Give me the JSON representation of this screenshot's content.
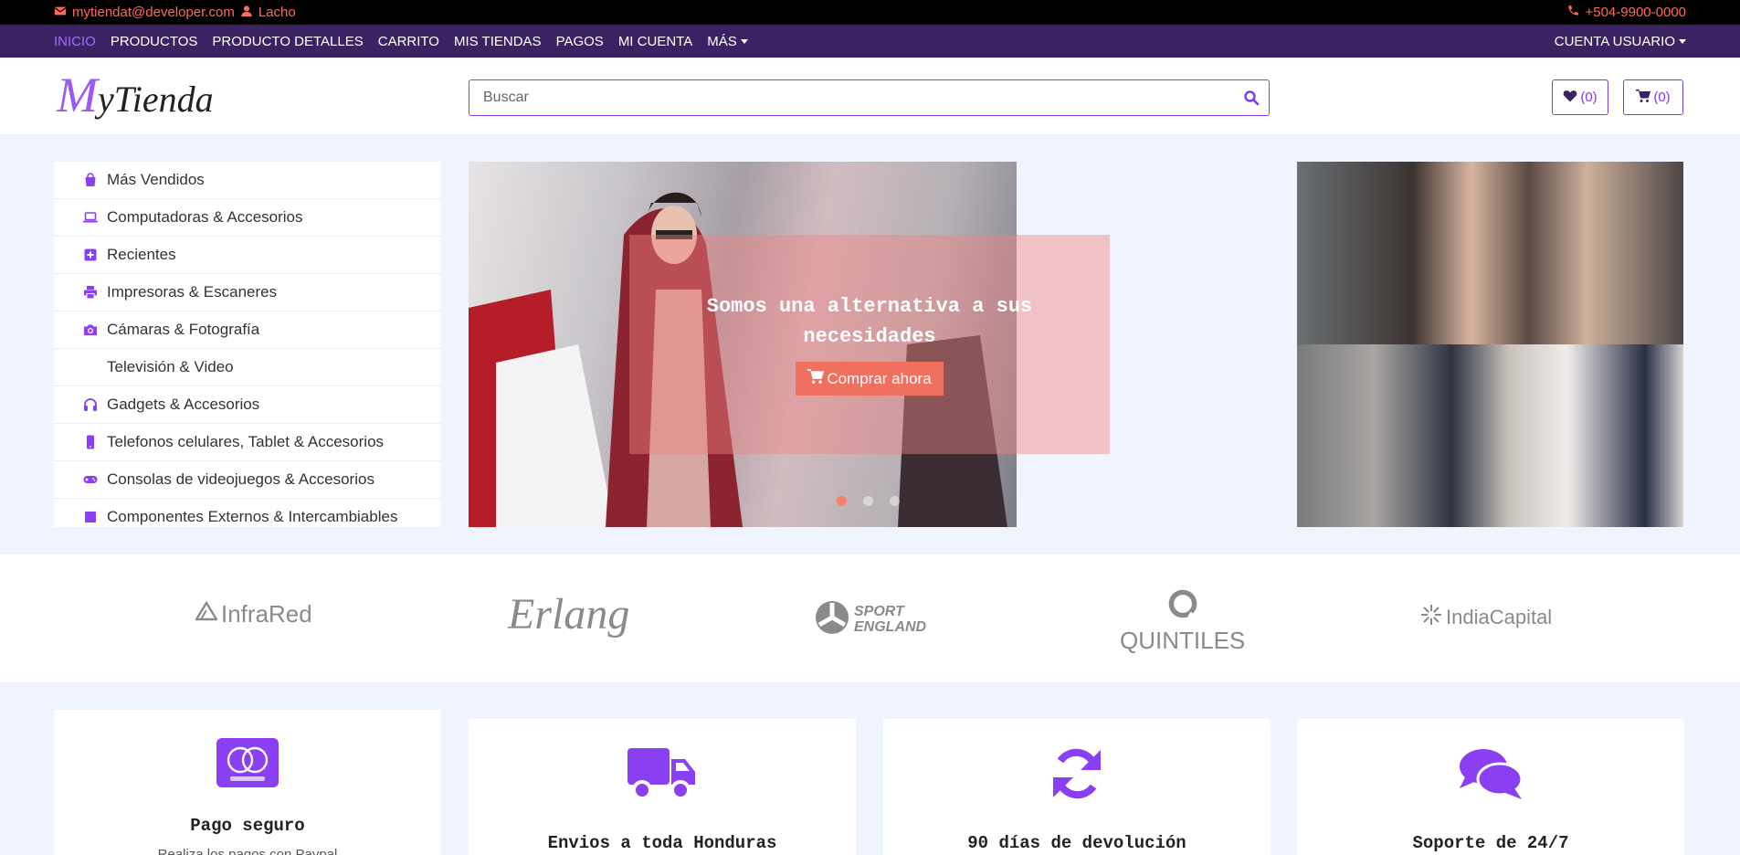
{
  "topbar": {
    "email": "mytiendat@developer.com",
    "user": "Lacho",
    "phone": "+504-9900-0000"
  },
  "nav": {
    "items": [
      {
        "label": "INICIO"
      },
      {
        "label": "PRODUCTOS"
      },
      {
        "label": "PRODUCTO DETALLES"
      },
      {
        "label": "CARRITO"
      },
      {
        "label": "MIS TIENDAS"
      },
      {
        "label": "PAGOS"
      },
      {
        "label": "MI CUENTA"
      },
      {
        "label": "MÁS"
      }
    ],
    "account": "CUENTA USUARIO"
  },
  "header": {
    "logo_m": "M",
    "logo_rest": "yTienda",
    "search_placeholder": "Buscar",
    "wishlist_count": "(0)",
    "cart_count": "(0)"
  },
  "categories": [
    {
      "label": "Más Vendidos",
      "icon": "shopping-bag-icon"
    },
    {
      "label": "Computadoras & Accesorios",
      "icon": "laptop-icon"
    },
    {
      "label": "Recientes",
      "icon": "plus-square-icon"
    },
    {
      "label": "Impresoras & Escaneres",
      "icon": "printer-icon"
    },
    {
      "label": "Cámaras & Fotografía",
      "icon": "camera-icon"
    },
    {
      "label": "Televisión & Video",
      "icon": ""
    },
    {
      "label": "Gadgets & Accesorios",
      "icon": "headphones-icon"
    },
    {
      "label": "Telefonos celulares, Tablet & Accesorios",
      "icon": "mobile-icon"
    },
    {
      "label": "Consolas de videojuegos & Accesorios",
      "icon": "gamepad-icon"
    },
    {
      "label": "Componentes Externos & Intercambiables",
      "icon": "component-icon"
    }
  ],
  "hero": {
    "title": "Somos una alternativa a sus necesidades",
    "button": "Comprar ahora"
  },
  "brands": [
    {
      "name": "InfraRed"
    },
    {
      "name": "Erlang"
    },
    {
      "name": "SPORT ENGLAND"
    },
    {
      "name": "QUINTILES"
    },
    {
      "name": "IndiaCapital"
    }
  ],
  "features": [
    {
      "title": "Pago seguro",
      "text": "Realiza los pagos con Paypal",
      "icon": "mastercard-icon"
    },
    {
      "title": "Envios a toda Honduras",
      "text": "",
      "icon": "truck-icon"
    },
    {
      "title": "90 días de devolución",
      "text": "",
      "icon": "refresh-icon"
    },
    {
      "title": "Soporte de 24/7",
      "text": "",
      "icon": "comments-icon"
    }
  ]
}
